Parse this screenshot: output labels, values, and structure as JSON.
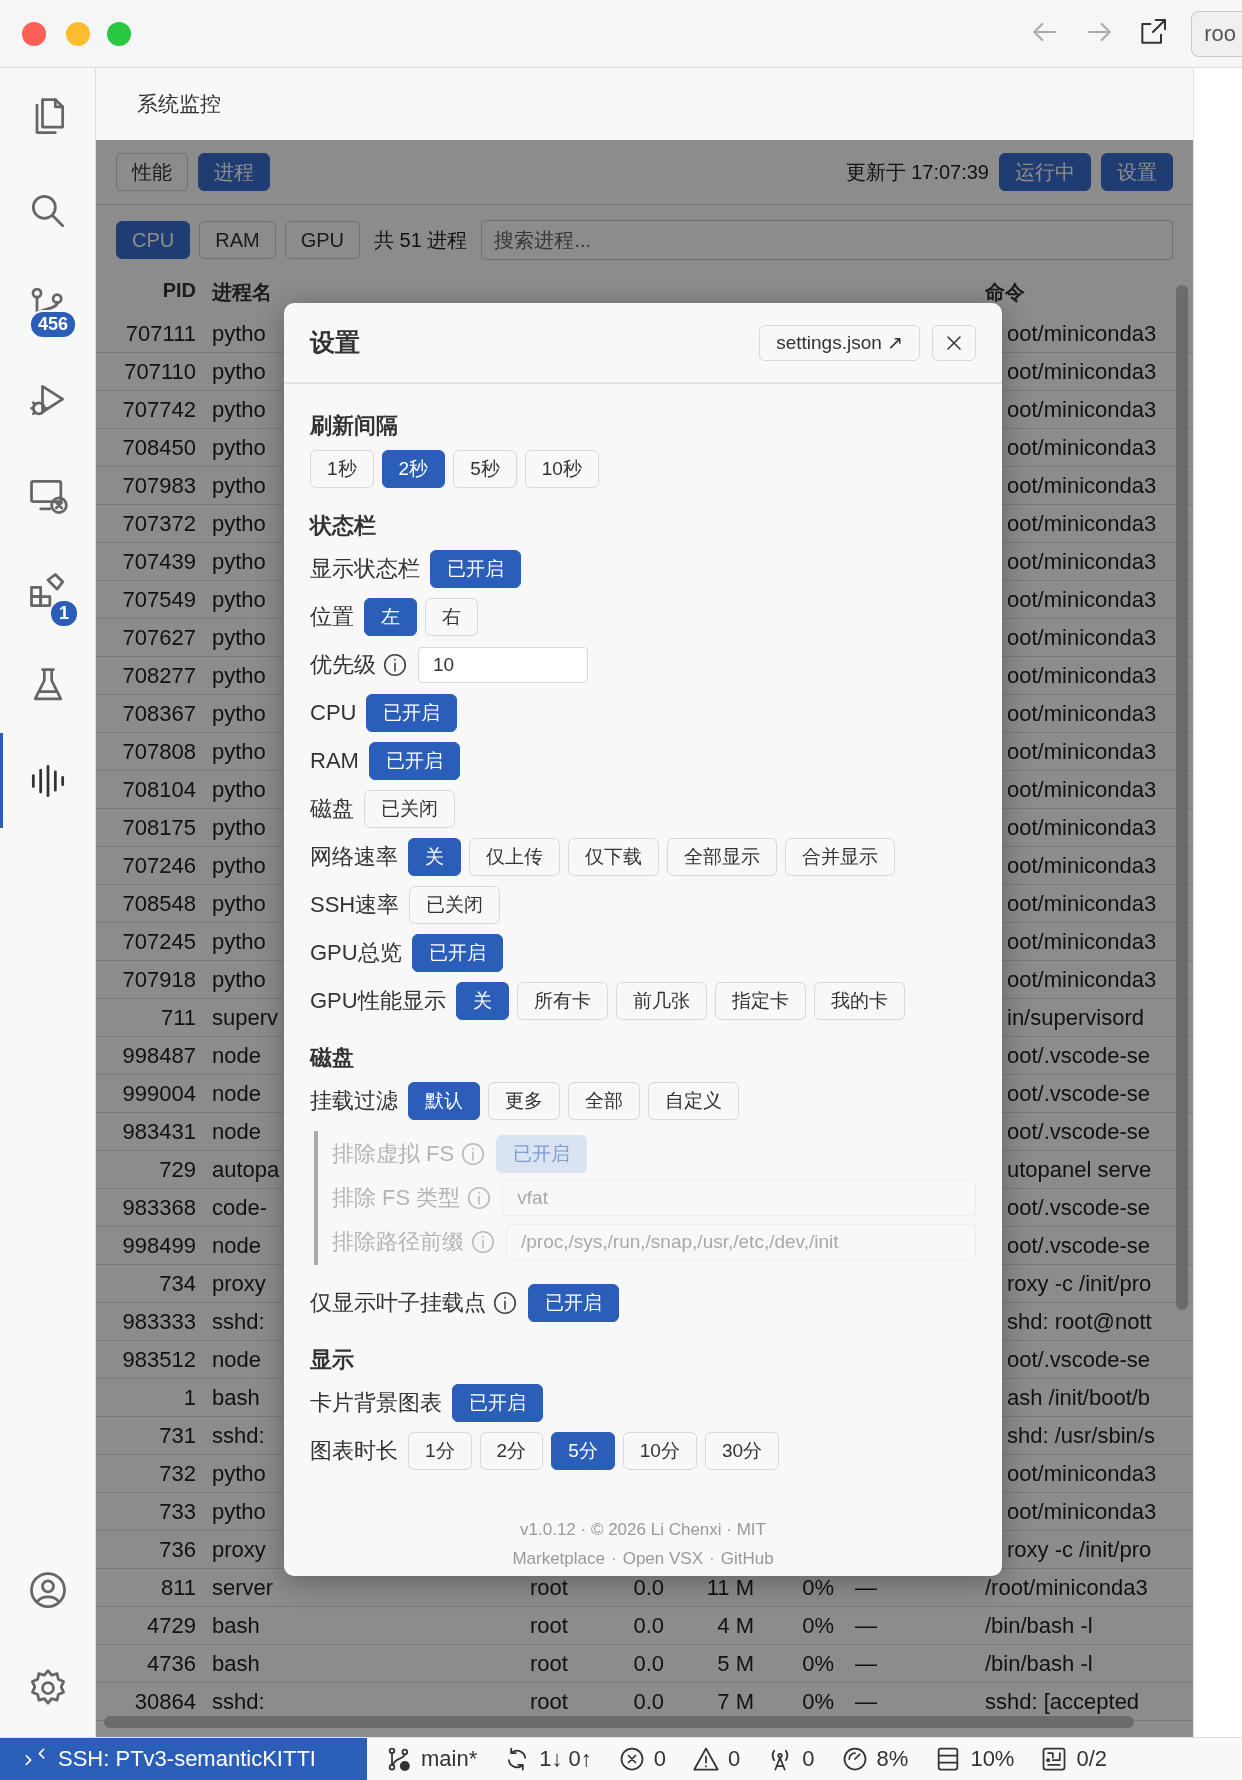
{
  "titlebar": {
    "address_text": "roo"
  },
  "activity_bar": [
    {
      "selected": false
    },
    {
      "selected": false
    },
    {
      "selected": false,
      "badge": "456"
    },
    {
      "selected": false
    },
    {
      "selected": false
    },
    {
      "selected": false,
      "badge": "1"
    },
    {
      "selected": false
    },
    {
      "selected": true
    },
    {
      "selected": false
    },
    {
      "selected": false
    }
  ],
  "editor_tab": {
    "title": "系统监控"
  },
  "toolbar": {
    "views": [
      {
        "label": "性能",
        "selected": false
      },
      {
        "label": "进程",
        "selected": true
      }
    ],
    "updated": "更新于 17:07:39",
    "buttons": [
      "运行中",
      "设置"
    ]
  },
  "filter_bar": {
    "sorts": [
      {
        "label": "CPU",
        "selected": true
      },
      {
        "label": "RAM",
        "selected": false
      },
      {
        "label": "GPU",
        "selected": false
      }
    ],
    "count": "共 51 进程",
    "search": {
      "placeholder": "搜索进程..."
    }
  },
  "table": {
    "columns": [
      "PID",
      "进程名",
      "命令"
    ],
    "rows": [
      {
        "pid": "707111",
        "name": "pytho",
        "command": "oot/miniconda3"
      },
      {
        "pid": "707110",
        "name": "pytho",
        "command": "oot/miniconda3"
      },
      {
        "pid": "707742",
        "name": "pytho",
        "command": "oot/miniconda3"
      },
      {
        "pid": "708450",
        "name": "pytho",
        "command": "oot/miniconda3"
      },
      {
        "pid": "707983",
        "name": "pytho",
        "command": "oot/miniconda3"
      },
      {
        "pid": "707372",
        "name": "pytho",
        "command": "oot/miniconda3"
      },
      {
        "pid": "707439",
        "name": "pytho",
        "command": "oot/miniconda3"
      },
      {
        "pid": "707549",
        "name": "pytho",
        "command": "oot/miniconda3"
      },
      {
        "pid": "707627",
        "name": "pytho",
        "command": "oot/miniconda3"
      },
      {
        "pid": "708277",
        "name": "pytho",
        "command": "oot/miniconda3"
      },
      {
        "pid": "708367",
        "name": "pytho",
        "command": "oot/miniconda3"
      },
      {
        "pid": "707808",
        "name": "pytho",
        "command": "oot/miniconda3"
      },
      {
        "pid": "708104",
        "name": "pytho",
        "command": "oot/miniconda3"
      },
      {
        "pid": "708175",
        "name": "pytho",
        "command": "oot/miniconda3"
      },
      {
        "pid": "707246",
        "name": "pytho",
        "command": "oot/miniconda3"
      },
      {
        "pid": "708548",
        "name": "pytho",
        "command": "oot/miniconda3"
      },
      {
        "pid": "707245",
        "name": "pytho",
        "command": "oot/miniconda3"
      },
      {
        "pid": "707918",
        "name": "pytho",
        "command": "oot/miniconda3"
      },
      {
        "pid": "711",
        "name": "superv",
        "command": "in/supervisord"
      },
      {
        "pid": "998487",
        "name": "node",
        "command": "oot/.vscode-se"
      },
      {
        "pid": "999004",
        "name": "node",
        "command": "oot/.vscode-se"
      },
      {
        "pid": "983431",
        "name": "node",
        "command": "oot/.vscode-se"
      },
      {
        "pid": "729",
        "name": "autopa",
        "command": "utopanel serve"
      },
      {
        "pid": "983368",
        "name": "code-",
        "command": "oot/.vscode-se"
      },
      {
        "pid": "998499",
        "name": "node",
        "command": "oot/.vscode-se"
      },
      {
        "pid": "734",
        "name": "proxy",
        "command": "roxy -c /init/pro"
      },
      {
        "pid": "983333",
        "name": "sshd:",
        "command": "shd: root@nott"
      },
      {
        "pid": "983512",
        "name": "node",
        "command": "oot/.vscode-se"
      },
      {
        "pid": "1",
        "name": "bash",
        "command": "ash /init/boot/b"
      },
      {
        "pid": "731",
        "name": "sshd:",
        "command": "shd: /usr/sbin/s"
      },
      {
        "pid": "732",
        "name": "pytho",
        "command": "oot/miniconda3"
      },
      {
        "pid": "733",
        "name": "pytho",
        "command": "oot/miniconda3"
      },
      {
        "pid": "736",
        "name": "proxy",
        "command": "roxy -c /init/pro"
      },
      {
        "pid": "811",
        "name": "server",
        "user": "root",
        "cpu": "0.0",
        "ram": "11 M",
        "ram_pct": "0%",
        "gpu": "—",
        "command": "/root/miniconda3"
      },
      {
        "pid": "4729",
        "name": "bash",
        "user": "root",
        "cpu": "0.0",
        "ram": "4 M",
        "ram_pct": "0%",
        "gpu": "—",
        "command": "/bin/bash -l"
      },
      {
        "pid": "4736",
        "name": "bash",
        "user": "root",
        "cpu": "0.0",
        "ram": "5 M",
        "ram_pct": "0%",
        "gpu": "—",
        "command": "/bin/bash -l"
      },
      {
        "pid": "30864",
        "name": "sshd:",
        "user": "root",
        "cpu": "0.0",
        "ram": "7 M",
        "ram_pct": "0%",
        "gpu": "—",
        "command": "sshd: [accepted"
      }
    ]
  },
  "settings_dialog": {
    "title": "设置",
    "file_button": "settings.json ↗",
    "sections": [
      {
        "heading": "刷新间隔",
        "rows": [
          {
            "kind": "options",
            "options": [
              {
                "label": "1秒",
                "selected": false
              },
              {
                "label": "2秒",
                "selected": true
              },
              {
                "label": "5秒",
                "selected": false
              },
              {
                "label": "10秒",
                "selected": false
              }
            ]
          }
        ]
      },
      {
        "heading": "状态栏",
        "rows": [
          {
            "kind": "toggle",
            "label": "显示状态栏",
            "on": true,
            "text": "已开启"
          },
          {
            "kind": "options",
            "label": "位置",
            "options": [
              {
                "label": "左",
                "selected": true
              },
              {
                "label": "右",
                "selected": false
              }
            ]
          },
          {
            "kind": "input",
            "label": "优先级",
            "info": true,
            "value": "10"
          },
          {
            "kind": "toggle",
            "label": "CPU",
            "on": true,
            "text": "已开启"
          },
          {
            "kind": "toggle",
            "label": "RAM",
            "on": true,
            "text": "已开启"
          },
          {
            "kind": "toggle",
            "label": "磁盘",
            "on": false,
            "text": "已关闭"
          },
          {
            "kind": "options",
            "label": "网络速率",
            "options": [
              {
                "label": "关",
                "selected": true
              },
              {
                "label": "仅上传",
                "selected": false
              },
              {
                "label": "仅下载",
                "selected": false
              },
              {
                "label": "全部显示",
                "selected": false
              },
              {
                "label": "合并显示",
                "selected": false
              }
            ]
          },
          {
            "kind": "toggle",
            "label": "SSH速率",
            "on": false,
            "text": "已关闭"
          },
          {
            "kind": "toggle",
            "label": "GPU总览",
            "on": true,
            "text": "已开启"
          },
          {
            "kind": "options",
            "label": "GPU性能显示",
            "options": [
              {
                "label": "关",
                "selected": true
              },
              {
                "label": "所有卡",
                "selected": false
              },
              {
                "label": "前几张",
                "selected": false
              },
              {
                "label": "指定卡",
                "selected": false
              },
              {
                "label": "我的卡",
                "selected": false
              }
            ]
          }
        ]
      },
      {
        "heading": "磁盘",
        "rows": [
          {
            "kind": "options",
            "label": "挂载过滤",
            "options": [
              {
                "label": "默认",
                "selected": true
              },
              {
                "label": "更多",
                "selected": false
              },
              {
                "label": "全部",
                "selected": false
              },
              {
                "label": "自定义",
                "selected": false
              }
            ]
          },
          {
            "kind": "group",
            "disabled": true,
            "rows": [
              {
                "kind": "toggle",
                "label": "排除虚拟 FS",
                "info": true,
                "on": true,
                "text": "已开启"
              },
              {
                "kind": "input",
                "label": "排除 FS 类型",
                "info": true,
                "value": "vfat"
              },
              {
                "kind": "input",
                "label": "排除路径前缀",
                "info": true,
                "value": "/proc,/sys,/run,/snap,/usr,/etc,/dev,/init"
              }
            ]
          },
          {
            "kind": "toggle",
            "label": "仅显示叶子挂载点",
            "info": true,
            "on": true,
            "text": "已开启"
          }
        ]
      },
      {
        "heading": "显示",
        "rows": [
          {
            "kind": "toggle",
            "label": "卡片背景图表",
            "on": true,
            "text": "已开启"
          },
          {
            "kind": "options",
            "label": "图表时长",
            "options": [
              {
                "label": "1分",
                "selected": false
              },
              {
                "label": "2分",
                "selected": false
              },
              {
                "label": "5分",
                "selected": true
              },
              {
                "label": "10分",
                "selected": false
              },
              {
                "label": "30分",
                "selected": false
              }
            ]
          }
        ]
      }
    ],
    "footer": {
      "credit": "v1.0.12 · © 2026 Li Chenxi · MIT",
      "links": [
        "Marketplace",
        "Open VSX",
        "GitHub"
      ],
      "separators": [
        "·",
        "·"
      ]
    }
  },
  "status_bar": [
    {
      "kind": "remote",
      "text": "SSH: PTv3-semanticKITTI"
    },
    {
      "kind": "branch",
      "text": "main*"
    },
    {
      "kind": "sync",
      "text": "1↓ 0↑"
    },
    {
      "kind": "errors",
      "text": "0"
    },
    {
      "kind": "warnings",
      "text": "0"
    },
    {
      "kind": "ports",
      "text": "0"
    },
    {
      "kind": "cpu",
      "text": "8%"
    },
    {
      "kind": "ram",
      "text": "10%"
    },
    {
      "kind": "gpu",
      "text": "0/2"
    }
  ]
}
